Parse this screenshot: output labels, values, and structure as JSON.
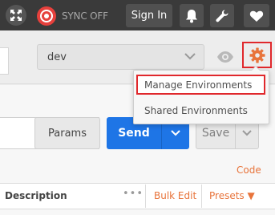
{
  "topbar": {
    "sync_label": "SYNC OFF",
    "signin_label": "Sign In",
    "icons": [
      "expand-icon",
      "sync-icon",
      "bell-icon",
      "wrench-icon",
      "heart-icon"
    ]
  },
  "environment": {
    "selected": "dev",
    "options_visible": [
      "dev"
    ]
  },
  "settings_menu": {
    "items": [
      {
        "label": "Manage Environments",
        "highlighted": true
      },
      {
        "label": "Shared Environments",
        "highlighted": false
      }
    ]
  },
  "request": {
    "params_label": "Params",
    "send_label": "Send",
    "save_label": "Save"
  },
  "body_section": {
    "code_link": "Code",
    "description_header": "Description",
    "more_label": "•••",
    "bulk_edit_label": "Bulk Edit",
    "presets_label": "Presets ▼"
  },
  "colors": {
    "accent_orange": "#e8743b",
    "send_blue": "#1e75e6",
    "highlight_red": "#e0282c",
    "topbar_bg": "#3a3a3a"
  }
}
